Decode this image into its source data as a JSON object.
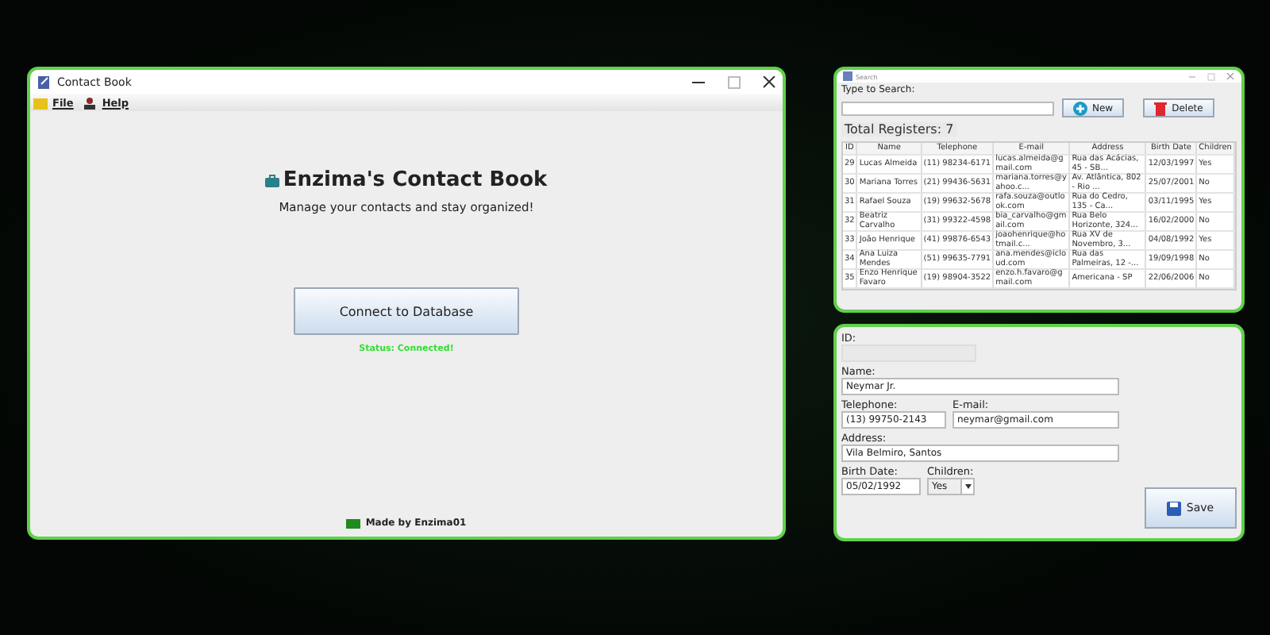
{
  "main_window": {
    "title": "Contact Book",
    "menu": [
      "File",
      "Help"
    ],
    "heading": "Enzima's Contact Book",
    "subtitle": "Manage your contacts and stay organized!",
    "connect_button": "Connect to Database",
    "status": "Status: Connected!",
    "footer": "Made by Enzima01"
  },
  "search_window": {
    "title": "Search",
    "search_label": "Type to Search:",
    "buttons": [
      {
        "label": "New",
        "kind": "new"
      },
      {
        "label": "Delete",
        "kind": "delete"
      }
    ],
    "total": "Total Registers: 7",
    "table": {
      "columns": [
        "ID",
        "Name",
        "Telephone",
        "E-mail",
        "Address",
        "Birth Date",
        "Children"
      ],
      "rows": [
        [
          "29",
          "Lucas Almeida",
          "(11) 98234-6171",
          "lucas.almeida@gmail.com",
          "Rua das Acácias, 45 - SB...",
          "12/03/1997",
          "Yes"
        ],
        [
          "30",
          "Mariana Torres",
          "(21) 99436-5631",
          "mariana.torres@yahoo.c...",
          "Av. Atlântica, 802 - Rio ...",
          "25/07/2001",
          "No"
        ],
        [
          "31",
          "Rafael Souza",
          "(19) 99632-5678",
          "rafa.souza@outlook.com",
          "Rua do Cedro, 135 - Ca...",
          "03/11/1995",
          "Yes"
        ],
        [
          "32",
          "Beatriz Carvalho",
          "(31) 99322-4598",
          "bia_carvalho@gmail.com",
          "Rua Belo Horizonte, 324...",
          "16/02/2000",
          "No"
        ],
        [
          "33",
          "João Henrique",
          "(41) 99876-6543",
          "joaohenrique@hotmail.c...",
          "Rua XV de Novembro, 3...",
          "04/08/1992",
          "Yes"
        ],
        [
          "34",
          "Ana Luiza Mendes",
          "(51) 99635-7791",
          "ana.mendes@icloud.com",
          "Rua das Palmeiras, 12 -...",
          "19/09/1998",
          "No"
        ],
        [
          "35",
          "Enzo Henrique Favaro",
          "(19) 98904-3522",
          "enzo.h.favaro@gmail.com",
          "Americana - SP",
          "22/06/2006",
          "No"
        ]
      ]
    }
  },
  "form_window": {
    "rows": [
      [
        {
          "label": "ID:",
          "kind": "id",
          "disabled": true
        }
      ],
      [
        {
          "label": "Name:",
          "kind": "name",
          "value": "Neymar Jr.",
          "disabled": false
        }
      ],
      [
        {
          "label": "Telephone:",
          "kind": "phone",
          "value": "(13) 99750-2143",
          "disabled": false
        },
        {
          "label": "E-mail:",
          "kind": "email",
          "value": "neymar@gmail.com",
          "disabled": false
        }
      ],
      [
        {
          "label": "Address:",
          "kind": "address",
          "value": "Vila Belmiro, Santos",
          "disabled": false
        }
      ],
      [
        {
          "label": "Birth Date:",
          "kind": "date",
          "value": "05/02/1992",
          "disabled": false
        },
        {
          "label": "Children:",
          "kind": "choice",
          "value": "Yes",
          "disabled": false
        }
      ]
    ],
    "save_button": "Save"
  }
}
